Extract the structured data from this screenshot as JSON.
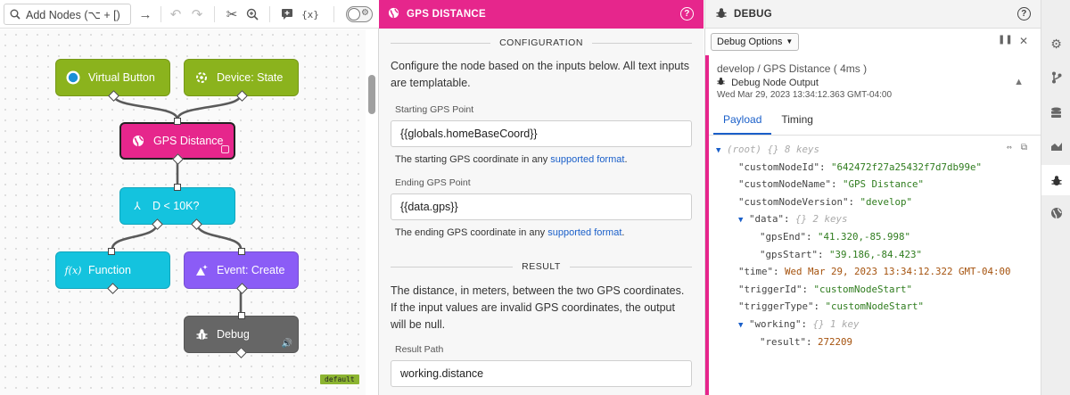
{
  "toolbar": {
    "add_nodes_placeholder": "Add Nodes (⌥ + [)",
    "icons": [
      "search-icon",
      "arrow-right-icon",
      "undo-icon",
      "redo-icon",
      "cut-icon",
      "zoom-in-icon",
      "comment-icon",
      "variables-icon",
      "settings-toggle"
    ]
  },
  "canvas": {
    "nodes": [
      {
        "label": "Virtual Button",
        "icon": "virtual-button-icon",
        "color": "#8bb31d"
      },
      {
        "label": "Device: State",
        "icon": "device-state-icon",
        "color": "#8bb31d"
      },
      {
        "label": "GPS Distance",
        "icon": "globe-icon",
        "color": "#e6268c"
      },
      {
        "label": "D < 10K?",
        "icon": "branch-icon",
        "color": "#14c3de"
      },
      {
        "label": "Function",
        "icon": "function-icon",
        "color": "#14c3de"
      },
      {
        "label": "Event: Create",
        "icon": "event-icon",
        "color": "#8b5cf6"
      },
      {
        "label": "Debug",
        "icon": "bug-icon",
        "color": "#666666"
      }
    ],
    "default_badge": "default"
  },
  "config": {
    "header_title": "GPS DISTANCE",
    "configuration_heading": "CONFIGURATION",
    "intro": "Configure the node based on the inputs below. All text inputs are templatable.",
    "starting_label": "Starting GPS Point",
    "starting_value": "{{globals.homeBaseCoord}}",
    "starting_help_prefix": "The starting GPS coordinate in any",
    "starting_help_link": "supported format",
    "ending_label": "Ending GPS Point",
    "ending_value": "{{data.gps}}",
    "ending_help_prefix": "The ending GPS coordinate in any",
    "ending_help_link": "supported format",
    "result_heading": "RESULT",
    "result_text": "The distance, in meters, between the two GPS coordinates. If the input values are invalid GPS coordinates, the output will be null.",
    "result_path_label": "Result Path",
    "result_path_value": "working.distance",
    "accent": "#e6268c",
    "link_color": "#1a5fc9"
  },
  "debug": {
    "header_title": "DEBUG",
    "options_label": "Debug Options",
    "message": {
      "title": "develop / GPS Distance ( 4ms )",
      "subtitle": "Debug Node Output",
      "timestamp": "Wed Mar 29, 2023 13:34:12.363 GMT-04:00"
    },
    "tabs": [
      "Payload",
      "Timing"
    ],
    "tree": {
      "root_label": "(root)",
      "root_meta": "{} 8 keys",
      "custom_node_id_key": "\"customNodeId\"",
      "custom_node_id_val": "\"642472f27a25432f7d7db99e\"",
      "custom_node_name_key": "\"customNodeName\"",
      "custom_node_name_val": "\"GPS Distance\"",
      "custom_node_version_key": "\"customNodeVersion\"",
      "custom_node_version_val": "\"develop\"",
      "data_key": "\"data\"",
      "data_meta": "{} 2 keys",
      "gps_end_key": "\"gpsEnd\"",
      "gps_end_val": "\"41.320,-85.998\"",
      "gps_start_key": "\"gpsStart\"",
      "gps_start_val": "\"39.186,-84.423\"",
      "time_key": "\"time\"",
      "time_val": "Wed Mar 29, 2023 13:34:12.322 GMT-04:00",
      "trigger_id_key": "\"triggerId\"",
      "trigger_id_val": "\"customNodeStart\"",
      "trigger_type_key": "\"triggerType\"",
      "trigger_type_val": "\"customNodeStart\"",
      "working_key": "\"working\"",
      "working_meta": "{} 1 key",
      "result_key": "\"result\"",
      "result_val": "272209"
    }
  },
  "sidebar": {
    "icons": [
      "gear-icon",
      "branch-icon",
      "storage-icon",
      "chart-icon",
      "bug-icon",
      "globe-icon"
    ],
    "active": "bug-icon"
  }
}
